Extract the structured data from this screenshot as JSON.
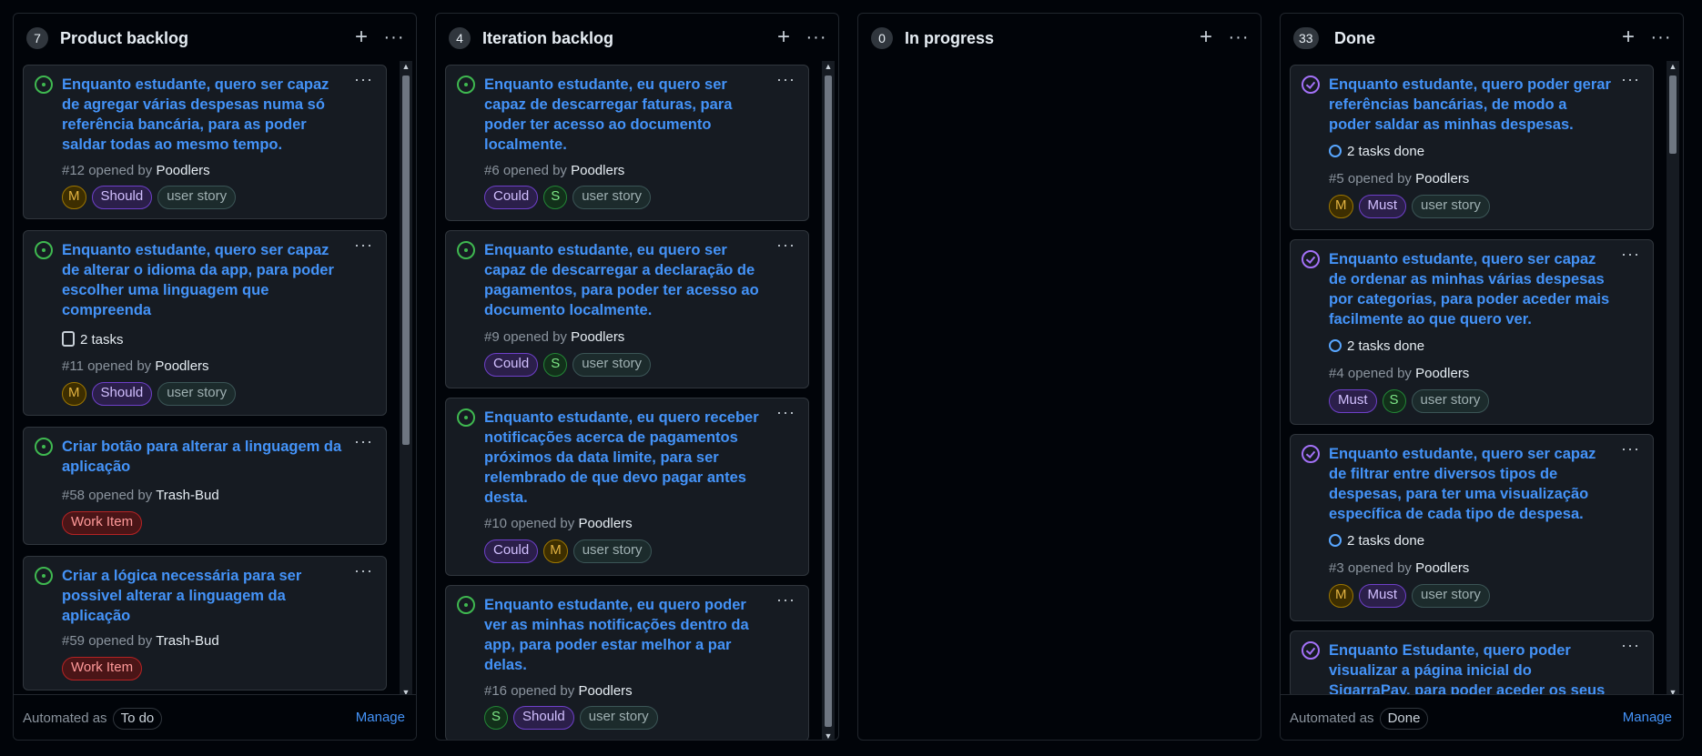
{
  "colors": {
    "open": "#3fb950",
    "done": "#a371f7",
    "link": "#4493f8"
  },
  "columns": [
    {
      "count": "7",
      "title": "Product backlog",
      "footer": {
        "automated_as": "Automated as",
        "status": "To do",
        "manage": "Manage"
      },
      "cards": [
        {
          "title": "Enquanto estudante, quero ser capaz de agregar várias despesas numa só referência bancária, para as poder saldar todas ao mesmo tempo.",
          "number": "#12",
          "opened_by": "opened by",
          "author": "Poodlers",
          "labels": [
            "M",
            "Should",
            "user story"
          ]
        },
        {
          "title": "Enquanto estudante, quero ser capaz de alterar o idioma da app, para poder escolher uma linguagem que compreenda",
          "tasks": "2 tasks",
          "number": "#11",
          "opened_by": "opened by",
          "author": "Poodlers",
          "labels": [
            "M",
            "Should",
            "user story"
          ]
        },
        {
          "title": "Criar botão para alterar a linguagem da aplicação",
          "number": "#58",
          "opened_by": "opened by",
          "author": "Trash-Bud",
          "labels": [
            "Work Item"
          ]
        },
        {
          "title": "Criar a lógica necessária para ser possivel alterar a linguagem da aplicação",
          "number": "#59",
          "opened_by": "opened by",
          "author": "Trash-Bud",
          "labels": [
            "Work Item"
          ]
        }
      ]
    },
    {
      "count": "4",
      "title": "Iteration backlog",
      "cards": [
        {
          "title": "Enquanto estudante, eu quero ser capaz de descarregar faturas, para poder ter acesso ao documento localmente.",
          "number": "#6",
          "opened_by": "opened by",
          "author": "Poodlers",
          "labels": [
            "Could",
            "S",
            "user story"
          ]
        },
        {
          "title": "Enquanto estudante, eu quero ser capaz de descarregar a declaração de pagamentos, para poder ter acesso ao documento localmente.",
          "number": "#9",
          "opened_by": "opened by",
          "author": "Poodlers",
          "labels": [
            "Could",
            "S",
            "user story"
          ]
        },
        {
          "title": "Enquanto estudante, eu quero receber notificações acerca de pagamentos próximos da data limite, para ser relembrado de que devo pagar antes desta.",
          "number": "#10",
          "opened_by": "opened by",
          "author": "Poodlers",
          "labels": [
            "Could",
            "M",
            "user story"
          ]
        },
        {
          "title": "Enquanto estudante, eu quero poder ver as minhas notificações dentro da app, para poder estar melhor a par delas.",
          "number": "#16",
          "opened_by": "opened by",
          "author": "Poodlers",
          "labels": [
            "S",
            "Should",
            "user story"
          ]
        }
      ]
    },
    {
      "count": "0",
      "title": "In progress",
      "cards": []
    },
    {
      "count": "33",
      "title": "Done",
      "footer": {
        "automated_as": "Automated as",
        "status": "Done",
        "manage": "Manage"
      },
      "cards": [
        {
          "title": "Enquanto estudante, quero poder gerar referências bancárias, de modo a poder saldar as minhas despesas.",
          "tasks": "2 tasks done",
          "number": "#5",
          "opened_by": "opened by",
          "author": "Poodlers",
          "labels": [
            "M",
            "Must",
            "user story"
          ]
        },
        {
          "title": "Enquanto estudante, quero ser capaz de ordenar as minhas várias despesas por categorias, para poder aceder mais facilmente ao que quero ver.",
          "tasks": "2 tasks done",
          "number": "#4",
          "opened_by": "opened by",
          "author": "Poodlers",
          "labels": [
            "Must",
            "S",
            "user story"
          ]
        },
        {
          "title": "Enquanto estudante, quero ser capaz de filtrar entre diversos tipos de despesas, para ter uma visualização específica de cada tipo de despesa.",
          "tasks": "2 tasks done",
          "number": "#3",
          "opened_by": "opened by",
          "author": "Poodlers",
          "labels": [
            "M",
            "Must",
            "user story"
          ]
        },
        {
          "title": "Enquanto Estudante, quero poder visualizar a página inicial do SigarraPay, para poder aceder os seus"
        }
      ]
    }
  ]
}
